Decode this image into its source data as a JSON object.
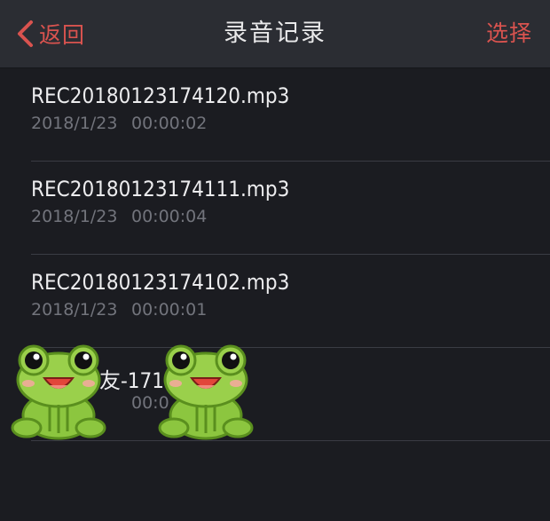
{
  "navbar": {
    "back_label": "返回",
    "title": "录音记录",
    "select_label": "选择",
    "accent_color": "#d9534f"
  },
  "recordings": [
    {
      "name": "REC20180123174120.mp3",
      "date": "2018/1/23",
      "duration": "00:00:02"
    },
    {
      "name": "REC20180123174111.mp3",
      "date": "2018/1/23",
      "duration": "00:00:04"
    },
    {
      "name": "REC20180123174102.mp3",
      "date": "2018/1/23",
      "duration": "00:00:01"
    },
    {
      "name": "室友-171   36.amr",
      "date": "",
      "duration": "00:0"
    }
  ],
  "overlay_icons": [
    "frog-emoji",
    "frog-emoji"
  ]
}
